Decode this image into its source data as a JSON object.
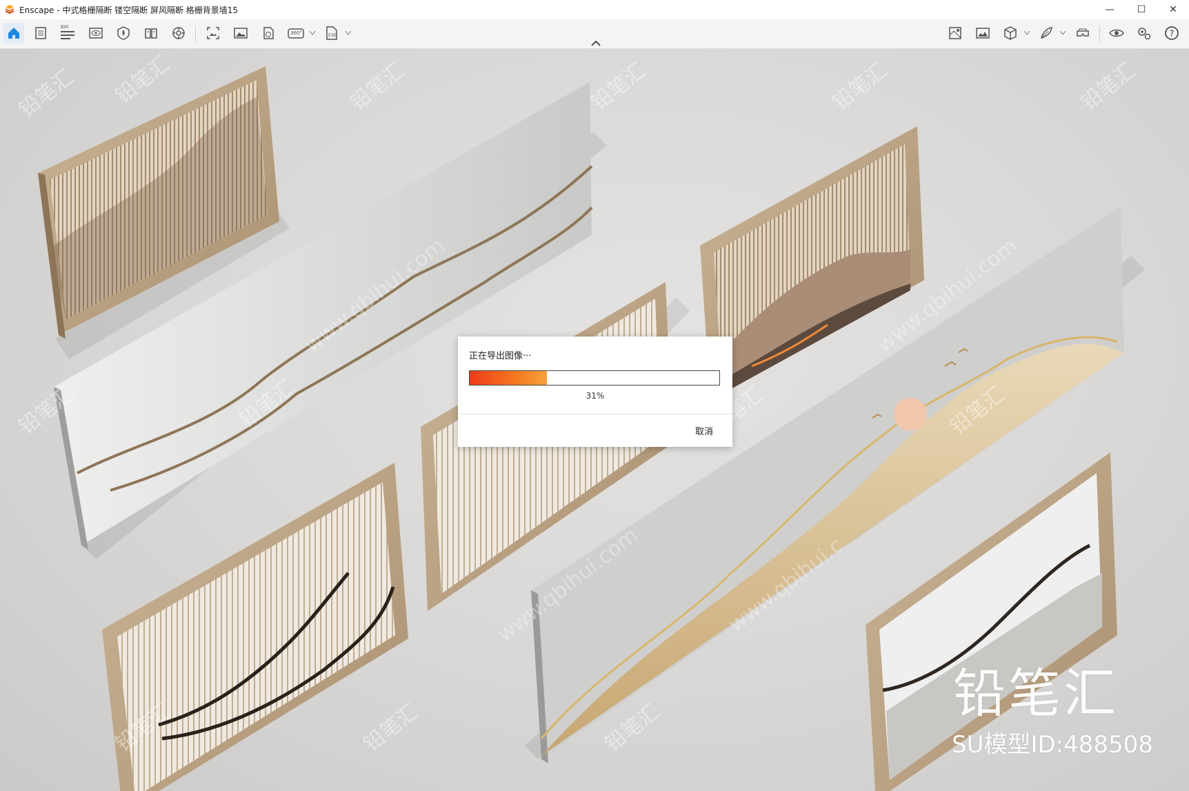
{
  "window": {
    "app_name": "Enscape",
    "title": "Enscape - 中式格栅隔断 镂空隔断 屏风隔断 格栅背景墙15",
    "minimize_glyph": "—",
    "maximize_glyph": "☐",
    "close_glyph": "✕"
  },
  "toolbar": {
    "left_buttons": [
      {
        "icon": "home-icon",
        "active": true
      },
      {
        "icon": "views-icon"
      },
      {
        "icon": "bim-icon"
      },
      {
        "icon": "visual-settings-icon"
      },
      {
        "icon": "asset-library-icon"
      },
      {
        "icon": "material-icon"
      },
      {
        "icon": "settings-wheel-icon"
      },
      {
        "icon": "capture-screenshot-icon"
      },
      {
        "icon": "image-export-icon"
      },
      {
        "icon": "panorama-icon"
      },
      {
        "icon": "video-360-icon"
      },
      {
        "icon": "exe-export-icon"
      }
    ],
    "right_buttons": [
      {
        "icon": "map-icon"
      },
      {
        "icon": "gallery-icon"
      },
      {
        "icon": "cube-icon"
      },
      {
        "icon": "feather-icon"
      },
      {
        "icon": "vr-headset-icon"
      },
      {
        "icon": "eye-icon"
      },
      {
        "icon": "gears-icon"
      },
      {
        "icon": "help-icon"
      }
    ],
    "bim_label": "BIM",
    "exe_label": "EXE",
    "video_label": "360°"
  },
  "dialog": {
    "title": "正在导出图像···",
    "progress": 0.31,
    "percent_text": "31%",
    "cancel_label": "取消"
  },
  "watermark": {
    "brand": "铅笔汇",
    "model_id": "SU模型ID:488508",
    "tile_text": "铅笔汇",
    "url_text": "www.qbihui.com",
    "url_text_alt": "www.qbihui.c"
  },
  "colors": {
    "accent_blue": "#1e88e5",
    "progress_start": "#ee3a1a",
    "progress_end": "#f6a23a",
    "frame_gold": "#b9a184"
  }
}
